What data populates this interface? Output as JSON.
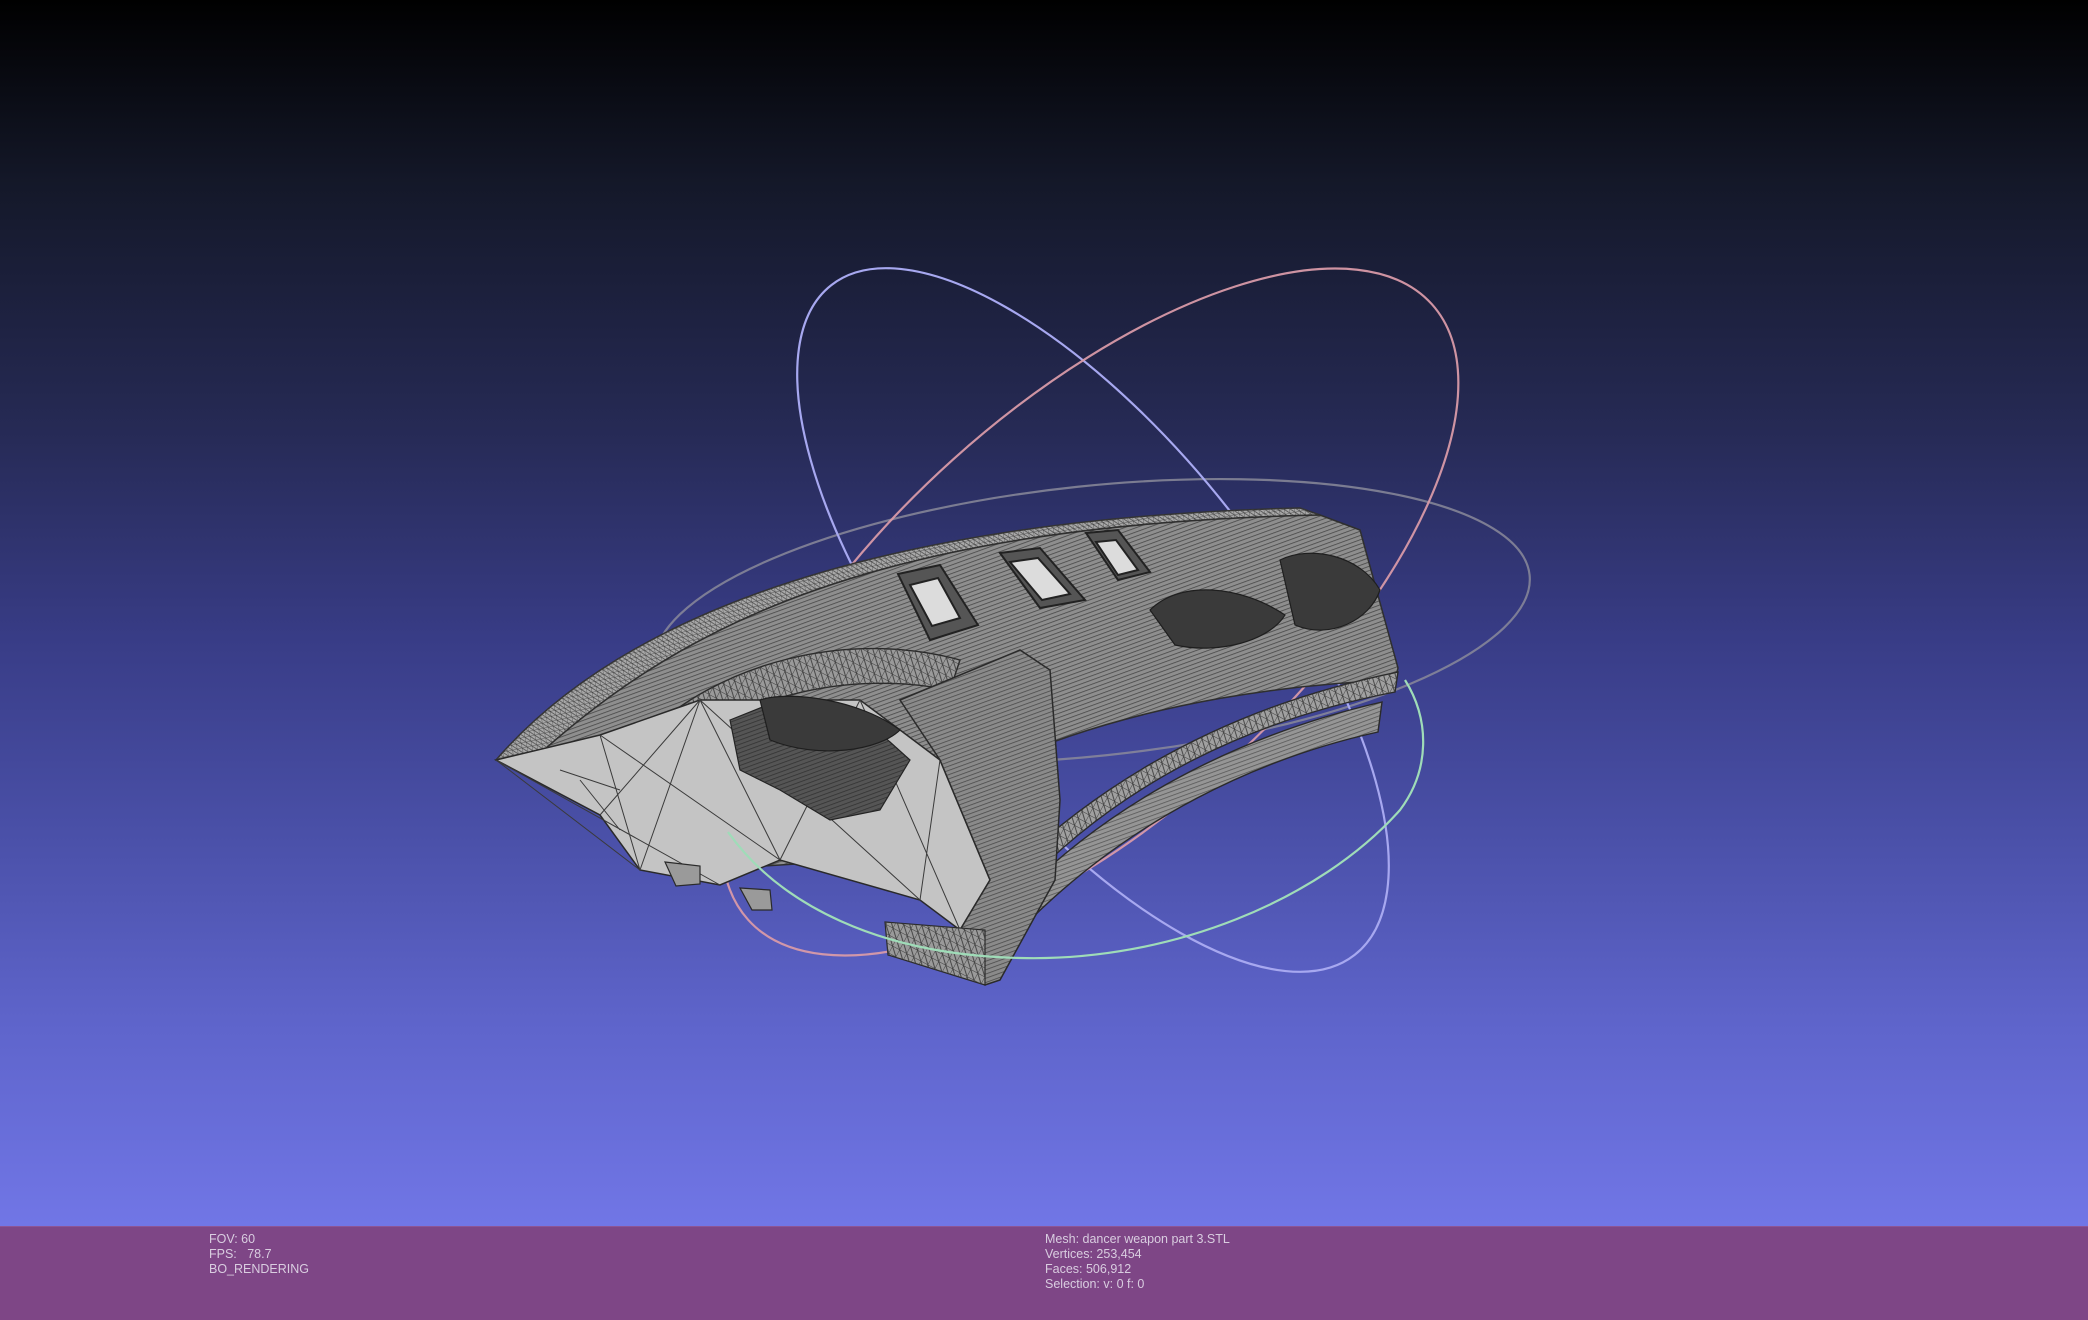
{
  "viewport": {
    "background_top": "#000000",
    "background_bottom": "#7176e6",
    "model_color": "#a9a9a9",
    "wire_color": "#3c3c3c",
    "trackball_colors": {
      "x": "#d89aa8",
      "y": "#a7a8f0",
      "z": "#9fdcb8",
      "neutral": "#8a8a9a"
    }
  },
  "info_left": {
    "fov": "FOV: 60",
    "fps": "FPS:   78.7",
    "render_mode": "BO_RENDERING"
  },
  "info_right": {
    "mesh": "Mesh: dancer weapon part 3.STL",
    "vertices": "Vertices: 253,454",
    "faces": "Faces: 506,912",
    "selection": "Selection: v: 0 f: 0"
  },
  "info_bar_color": "#7e4686"
}
